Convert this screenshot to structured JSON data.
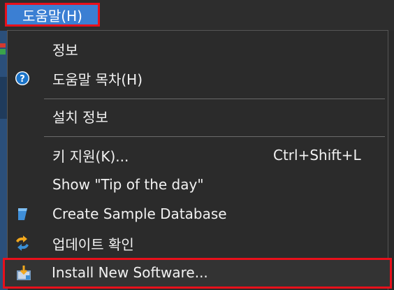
{
  "menubar": {
    "help_label": "도움말(H)"
  },
  "help_menu": {
    "items": [
      {
        "label": "정보",
        "icon": "",
        "shortcut": ""
      },
      {
        "label": "도움말 목차(H)",
        "icon": "help-circle-icon",
        "shortcut": ""
      },
      {
        "label": "설치 정보",
        "icon": "",
        "shortcut": ""
      },
      {
        "label": "키 지원(K)...",
        "icon": "",
        "shortcut": "Ctrl+Shift+L"
      },
      {
        "label": "Show \"Tip of the day\"",
        "icon": "",
        "shortcut": ""
      },
      {
        "label": "Create Sample Database",
        "icon": "database-icon",
        "shortcut": ""
      },
      {
        "label": "업데이트 확인",
        "icon": "update-arrows-icon",
        "shortcut": ""
      },
      {
        "label": "Install New Software...",
        "icon": "install-software-icon",
        "shortcut": ""
      }
    ]
  },
  "colors": {
    "menu_background": "#2b2b2b",
    "menubar_selected": "#3b7fd3",
    "highlight_border": "#e8101b",
    "text": "#f2f2f2"
  }
}
